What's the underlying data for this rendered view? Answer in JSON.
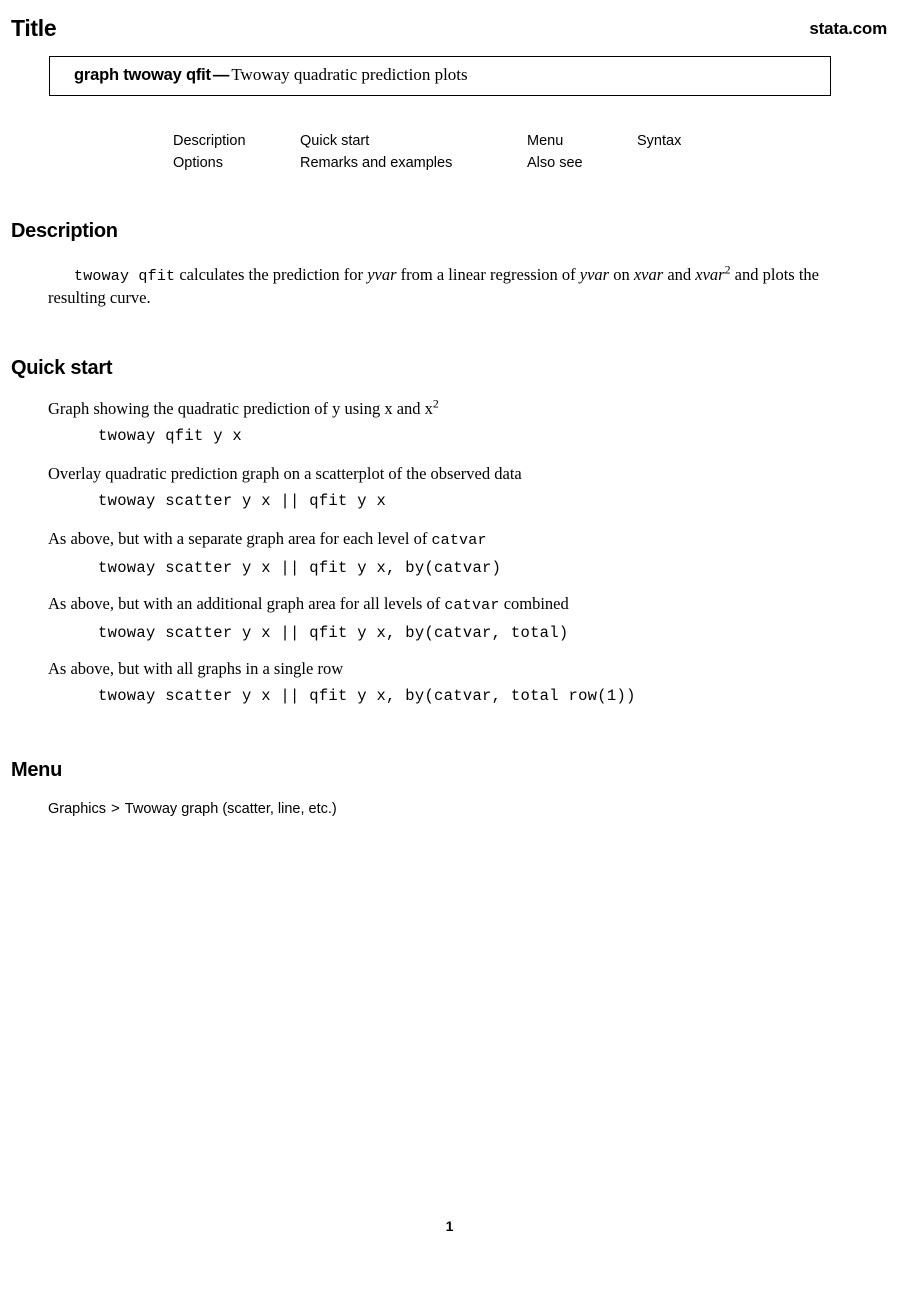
{
  "header": {
    "title_word": "Title",
    "site": "stata.com"
  },
  "title_box": {
    "command": "graph twoway qfit",
    "dash": "—",
    "description": "Twoway quadratic prediction plots"
  },
  "nav": {
    "columns": [
      {
        "links": [
          "Description",
          "Options"
        ]
      },
      {
        "links": [
          "Quick start",
          "Remarks and examples"
        ]
      },
      {
        "links": [
          "Menu",
          "Also see"
        ]
      },
      {
        "links": [
          "Syntax"
        ]
      }
    ]
  },
  "sections": {
    "description": {
      "heading": "Description",
      "body": {
        "cmd1": "twoway qfit",
        "t1": " calculates the prediction for ",
        "i1": "yvar",
        "t2": " from a linear regression of ",
        "i2": "yvar",
        "t3": " on ",
        "i3": "xvar",
        "t4": " and ",
        "i4": "xvar",
        "sup4": "2",
        "t5": " and plots the resulting curve."
      }
    },
    "quick_start": {
      "heading": "Quick start",
      "items": [
        {
          "text_pre": "Graph showing the quadratic prediction of y using x and x",
          "text_sup": "2",
          "text_post": "",
          "code": "twoway qfit y x"
        },
        {
          "text_pre": "Overlay quadratic prediction graph on a scatterplot of the observed data",
          "text_sup": "",
          "text_post": "",
          "code": "twoway scatter y x || qfit y x"
        },
        {
          "text_pre": "As above, but with a separate graph area for each level of ",
          "text_mono": "catvar",
          "text_post": "",
          "code": "twoway scatter y x || qfit y x, by(catvar)"
        },
        {
          "text_pre": "As above, but with an additional graph area for all levels of ",
          "text_mono": "catvar",
          "text_post": " combined",
          "code": "twoway scatter y x || qfit y x, by(catvar, total)"
        },
        {
          "text_pre": "As above, but with all graphs in a single row",
          "text_mono": "",
          "text_post": "",
          "code": "twoway scatter y x || qfit y x, by(catvar, total row(1))"
        }
      ]
    },
    "menu": {
      "heading": "Menu",
      "path_root": "Graphics",
      "separator": ">",
      "path_leaf": "Twoway graph (scatter, line, etc.)"
    }
  },
  "footer": {
    "page_number": "1"
  }
}
